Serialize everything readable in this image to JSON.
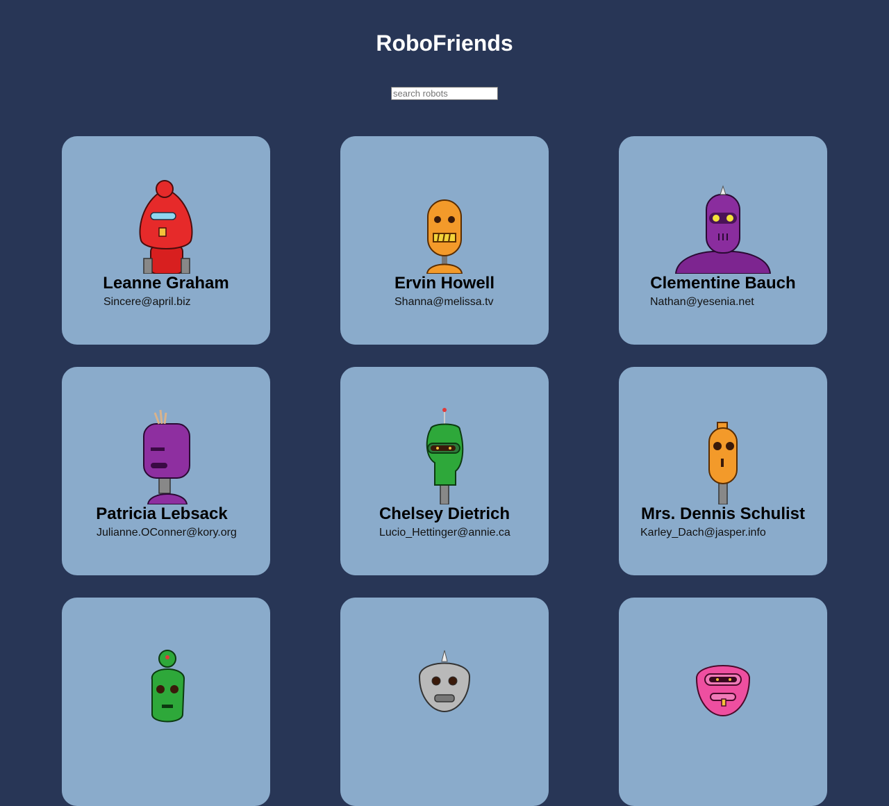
{
  "header": {
    "title": "RoboFriends"
  },
  "search": {
    "placeholder": "search robots",
    "value": ""
  },
  "robots": [
    {
      "name": "Leanne Graham",
      "email": "Sincere@april.biz",
      "color": "#e62a2a",
      "icon": "red-robot-icon"
    },
    {
      "name": "Ervin Howell",
      "email": "Shanna@melissa.tv",
      "color": "#f39a2a",
      "icon": "orange-robot-icon"
    },
    {
      "name": "Clementine Bauch",
      "email": "Nathan@yesenia.net",
      "color": "#8a2d9e",
      "icon": "purple-robot-icon"
    },
    {
      "name": "Patricia Lebsack",
      "email": "Julianne.OConner@kory.org",
      "color": "#8e2fa0",
      "icon": "purple-robot-icon"
    },
    {
      "name": "Chelsey Dietrich",
      "email": "Lucio_Hettinger@annie.ca",
      "color": "#2ea83a",
      "icon": "green-robot-icon"
    },
    {
      "name": "Mrs. Dennis Schulist",
      "email": "Karley_Dach@jasper.info",
      "color": "#f39a2a",
      "icon": "orange-robot-icon"
    },
    {
      "name": "",
      "email": "",
      "color": "#2ea83a",
      "icon": "green-robot-icon"
    },
    {
      "name": "",
      "email": "",
      "color": "#b9b9b9",
      "icon": "gray-robot-icon"
    },
    {
      "name": "",
      "email": "",
      "color": "#ee4fa0",
      "icon": "pink-robot-icon"
    }
  ]
}
